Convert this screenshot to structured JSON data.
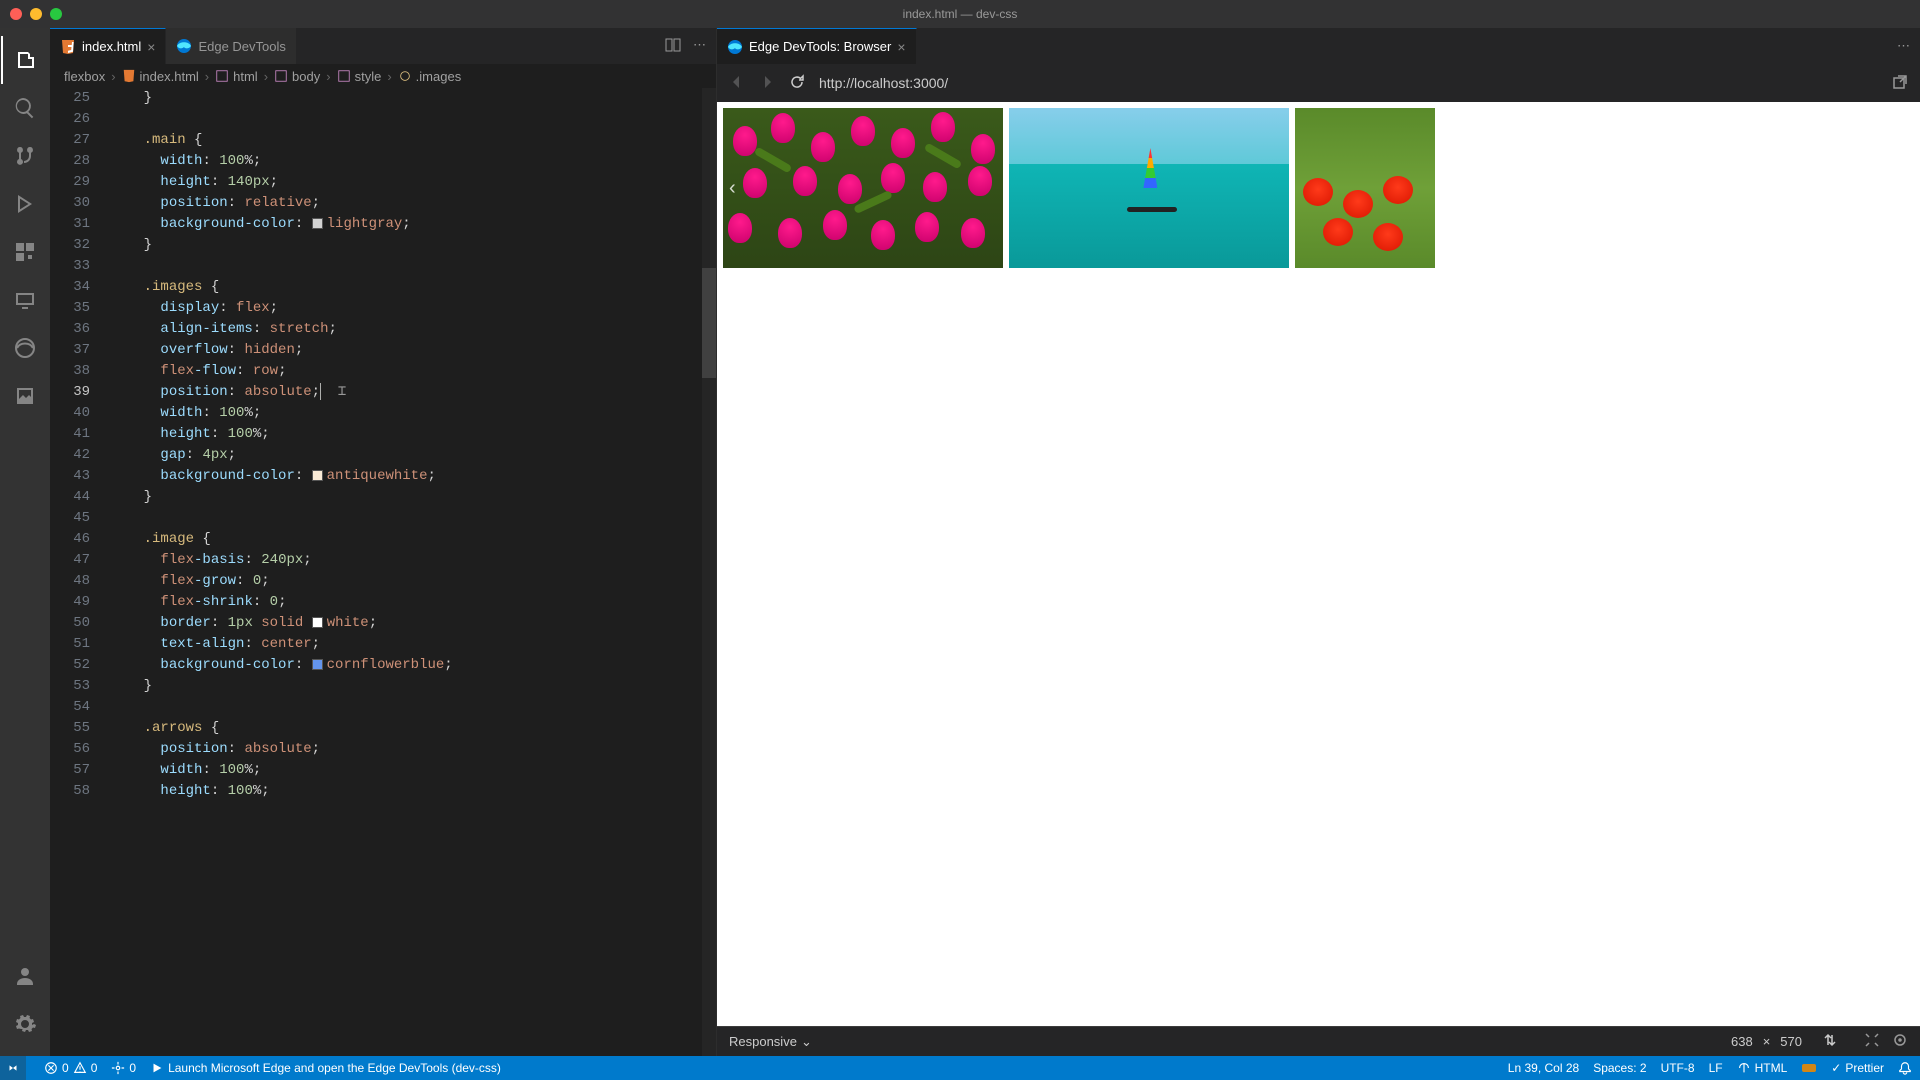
{
  "window": {
    "title": "index.html — dev-css"
  },
  "tabs_left": [
    {
      "label": "index.html",
      "icon": "html-file-icon",
      "active": true
    },
    {
      "label": "Edge DevTools",
      "icon": "edge-icon",
      "active": false
    }
  ],
  "tabs_right": [
    {
      "label": "Edge DevTools: Browser",
      "icon": "edge-icon",
      "active": true
    }
  ],
  "breadcrumb": [
    "flexbox",
    "index.html",
    "html",
    "body",
    "style",
    ".images"
  ],
  "editor": {
    "first_line": 25,
    "active_line": 39,
    "lines": [
      "    }",
      "",
      "    .main {",
      "      width: 100%;",
      "      height: 140px;",
      "      position: relative;",
      "      background-color: lightgray;",
      "    }",
      "",
      "    .images {",
      "      display: flex;",
      "      align-items: stretch;",
      "      overflow: hidden;",
      "      flex-flow: row;",
      "      position: absolute;",
      "      width: 100%;",
      "      height: 100%;",
      "      gap: 4px;",
      "      background-color: antiquewhite;",
      "    }",
      "",
      "    .image {",
      "      flex-basis: 240px;",
      "      flex-grow: 0;",
      "      flex-shrink: 0;",
      "      border: 1px solid white;",
      "      text-align: center;",
      "      background-color: cornflowerblue;",
      "    }",
      "",
      "    .arrows {",
      "      position: absolute;",
      "      width: 100%;",
      "      height: 100%;"
    ]
  },
  "colors": {
    "lightgray": "#d3d3d3",
    "antiquewhite": "#faebd7",
    "white": "#ffffff",
    "cornflowerblue": "#6495ed"
  },
  "browser": {
    "url": "http://localhost:3000/",
    "responsive_label": "Responsive",
    "width": "638",
    "sep": "×",
    "height": "570"
  },
  "status": {
    "errors": "0",
    "warnings": "0",
    "ports": "0",
    "launch_msg": "Launch Microsoft Edge and open the Edge DevTools (dev-css)",
    "cursor_pos": "Ln 39, Col 28",
    "spaces": "Spaces: 2",
    "encoding": "UTF-8",
    "eol": "LF",
    "lang": "HTML",
    "prettier": "Prettier"
  }
}
